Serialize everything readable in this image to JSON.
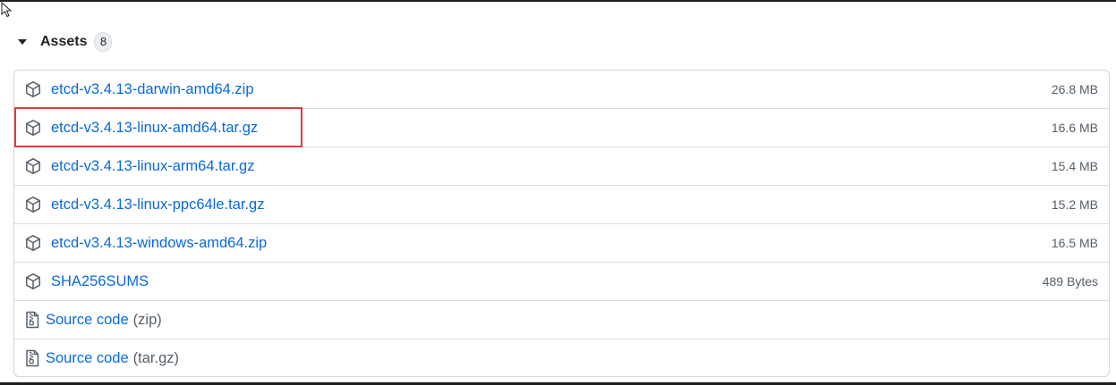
{
  "assets": {
    "title": "Assets",
    "count": "8",
    "items": [
      {
        "name": "etcd-v3.4.13-darwin-amd64.zip",
        "size": "26.8 MB",
        "icon": "package-icon"
      },
      {
        "name": "etcd-v3.4.13-linux-amd64.tar.gz",
        "size": "16.6 MB",
        "icon": "package-icon"
      },
      {
        "name": "etcd-v3.4.13-linux-arm64.tar.gz",
        "size": "15.4 MB",
        "icon": "package-icon"
      },
      {
        "name": "etcd-v3.4.13-linux-ppc64le.tar.gz",
        "size": "15.2 MB",
        "icon": "package-icon"
      },
      {
        "name": "etcd-v3.4.13-windows-amd64.zip",
        "size": "16.5 MB",
        "icon": "package-icon"
      },
      {
        "name": "SHA256SUMS",
        "size": "489 Bytes",
        "icon": "package-icon"
      }
    ],
    "source": [
      {
        "label": "Source code",
        "suffix": "(zip)",
        "icon": "file-zip-icon"
      },
      {
        "label": "Source code",
        "suffix": "(tar.gz)",
        "icon": "file-zip-icon"
      }
    ]
  },
  "highlight_color": "#e03c3c",
  "link_color": "#0969da"
}
